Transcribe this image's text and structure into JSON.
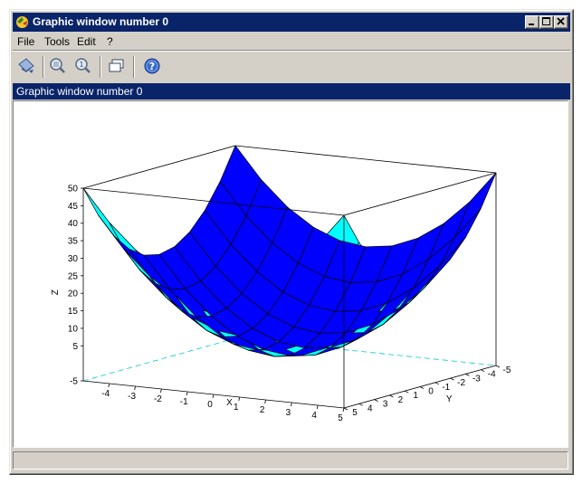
{
  "window": {
    "title": "Graphic window number 0"
  },
  "menu": [
    "File",
    "Tools",
    "Edit",
    "?"
  ],
  "toolbar": {
    "icons": [
      "rotate-icon",
      "zoom-icon",
      "unzoom-icon",
      "datatip-icon",
      "help-icon"
    ]
  },
  "info_bar": {
    "text": "Graphic window number 0"
  },
  "status_bar": {
    "text": ""
  },
  "colors": {
    "title_bar": "#0a246a",
    "surface_front": "#00ffff",
    "surface_back": "#0000ff",
    "chrome": "#d4d0c8"
  },
  "chart_data": {
    "type": "surface3d",
    "title": "",
    "xlabel": "X",
    "ylabel": "Y",
    "zlabel": "Z",
    "function": "z = x^2 + y^2",
    "x": [
      -5,
      -4,
      -3,
      -2,
      -1,
      0,
      1,
      2,
      3,
      4,
      5
    ],
    "y": [
      -5,
      -4,
      -3,
      -2,
      -1,
      0,
      1,
      2,
      3,
      4,
      5
    ],
    "x_ticks": [
      "-4",
      "-3",
      "-2",
      "-1",
      "0",
      "1",
      "2",
      "3",
      "4",
      "5"
    ],
    "y_ticks": [
      "-5",
      "-4",
      "-3",
      "-2",
      "-1",
      "0",
      "1",
      "2",
      "3",
      "4",
      "5"
    ],
    "z_ticks": [
      "-5",
      "5",
      "10",
      "15",
      "20",
      "25",
      "30",
      "35",
      "40",
      "45",
      "50"
    ],
    "xlim": [
      -5,
      5
    ],
    "ylim": [
      -5,
      5
    ],
    "zlim": [
      -5,
      50
    ],
    "grid": false
  }
}
